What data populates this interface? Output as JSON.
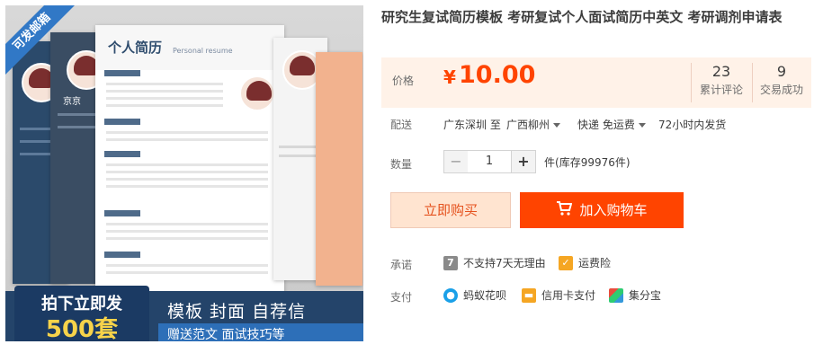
{
  "gallery": {
    "ribbon": "可发邮箱",
    "resume_title_cn": "个人简历",
    "resume_title_en": "Personal resume",
    "side_resume_name": "京京",
    "banner_left_line1": "拍下立即发",
    "banner_left_line2": "500套",
    "banner_right_line1": "模板  封面  自荐信",
    "banner_right_line2": "赠送范文   面试技巧等"
  },
  "product": {
    "title": "研究生复试简历模板 考研复试个人面试简历中英文 考研调剂申请表"
  },
  "price": {
    "label": "价格",
    "currency": "¥",
    "value": "10.00",
    "reviews_count": "23",
    "reviews_label": "累计评论",
    "sales_count": "9",
    "sales_label": "交易成功"
  },
  "shipping": {
    "label": "配送",
    "from": "广东深圳 至",
    "to": "广西柳州",
    "method": "快递 免运费",
    "time": "72小时内发货"
  },
  "quantity": {
    "label": "数量",
    "minus": "−",
    "value": "1",
    "plus": "+",
    "unit": "件",
    "stock": "(库存99976件)"
  },
  "actions": {
    "buy_now": "立即购买",
    "add_to_cart": "加入购物车"
  },
  "promise": {
    "label": "承诺",
    "items": [
      {
        "icon": "seven-day-icon",
        "text": "不支持7天无理由"
      },
      {
        "icon": "shipping-insurance-icon",
        "text": "运费险"
      }
    ]
  },
  "payment": {
    "label": "支付",
    "items": [
      {
        "icon": "huabei-icon",
        "text": "蚂蚁花呗"
      },
      {
        "icon": "credit-card-icon",
        "text": "信用卡支付"
      },
      {
        "icon": "jifenbao-icon",
        "text": "集分宝"
      }
    ]
  },
  "colors": {
    "accent": "#ff4400",
    "price": "#ff4400",
    "price_bg": "#fff2e8",
    "buy_now_bg": "#ffe4d0"
  }
}
